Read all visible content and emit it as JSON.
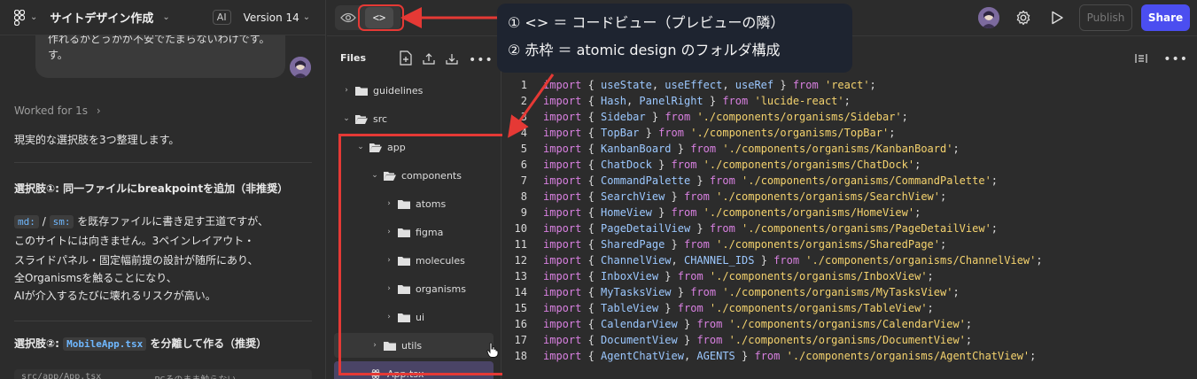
{
  "header": {
    "project_title": "サイトデザイン作成",
    "ai_badge": "AI",
    "version": "Version 14"
  },
  "chat": {
    "bubble_text": "作れるかどうかが不安でたまらないわけです。",
    "bubble_line2": "す。",
    "worked_label": "Worked for 1s",
    "intro": "現実的な選択肢を3つ整理します。",
    "option1_title": "選択肢①: 同一ファイルにbreakpointを追加（非推奨）",
    "option1_chip_a": "md:",
    "option1_sep": "/",
    "option1_chip_b": "sm:",
    "option1_line1_rest": "を既存ファイルに書き足す王道ですが、",
    "option1_line2": "このサイトには向きません。3ペインレイアウト・",
    "option1_line3": "スライドパネル・固定幅前提の設計が随所にあり、",
    "option1_line4": "全Organismsを触ることになり、",
    "option1_line5": "AIが介入するたびに壊れるリスクが高い。",
    "option2_prefix": "選択肢②:",
    "option2_chip": "MobileApp.tsx",
    "option2_rest": "を分離して作る（推奨）",
    "snippet_left": "src/app/App.tsx",
    "snippet_right": "PCそのまま触らない"
  },
  "toolbar": {
    "publish_label": "Publish",
    "share_label": "Share",
    "code_glyph": "<>"
  },
  "files": {
    "title": "Files",
    "tree": [
      {
        "label": "guidelines",
        "depth": 0,
        "expanded": false
      },
      {
        "label": "src",
        "depth": 0,
        "expanded": true
      },
      {
        "label": "app",
        "depth": 1,
        "expanded": true
      },
      {
        "label": "components",
        "depth": 2,
        "expanded": true
      },
      {
        "label": "atoms",
        "depth": 3,
        "expanded": false
      },
      {
        "label": "figma",
        "depth": 3,
        "expanded": false
      },
      {
        "label": "molecules",
        "depth": 3,
        "expanded": false
      },
      {
        "label": "organisms",
        "depth": 3,
        "expanded": false
      },
      {
        "label": "ui",
        "depth": 3,
        "expanded": false
      },
      {
        "label": "utils",
        "depth": 2,
        "expanded": false
      }
    ],
    "selected_file": "App.tsx"
  },
  "editor": {
    "lines": [
      {
        "n": "1",
        "names": "useState, useEffect, useRef",
        "path": "'react'"
      },
      {
        "n": "2",
        "names": "Hash, PanelRight",
        "path": "'lucide-react'"
      },
      {
        "n": "3",
        "names": "Sidebar",
        "path": "'./components/organisms/Sidebar'"
      },
      {
        "n": "4",
        "names": "TopBar",
        "path": "'./components/organisms/TopBar'"
      },
      {
        "n": "5",
        "names": "KanbanBoard",
        "path": "'./components/organisms/KanbanBoard'"
      },
      {
        "n": "6",
        "names": "ChatDock",
        "path": "'./components/organisms/ChatDock'"
      },
      {
        "n": "7",
        "names": "CommandPalette",
        "path": "'./components/organisms/CommandPalette'"
      },
      {
        "n": "8",
        "names": "SearchView",
        "path": "'./components/organisms/SearchView'"
      },
      {
        "n": "9",
        "names": "HomeView",
        "path": "'./components/organisms/HomeView'"
      },
      {
        "n": "10",
        "names": "PageDetailView",
        "path": "'./components/organisms/PageDetailView'"
      },
      {
        "n": "11",
        "names": "SharedPage",
        "path": "'./components/organisms/SharedPage'"
      },
      {
        "n": "12",
        "names": "ChannelView, CHANNEL_IDS",
        "path": "'./components/organisms/ChannelView'"
      },
      {
        "n": "13",
        "names": "InboxView",
        "path": "'./components/organisms/InboxView'"
      },
      {
        "n": "14",
        "names": "MyTasksView",
        "path": "'./components/organisms/MyTasksView'"
      },
      {
        "n": "15",
        "names": "TableView",
        "path": "'./components/organisms/TableView'"
      },
      {
        "n": "16",
        "names": "CalendarView",
        "path": "'./components/organisms/CalendarView'"
      },
      {
        "n": "17",
        "names": "DocumentView",
        "path": "'./components/organisms/DocumentView'"
      },
      {
        "n": "18",
        "names": "AgentChatView, AGENTS",
        "path": "'./components/organisms/AgentChatView'"
      }
    ],
    "kw_import": "import",
    "kw_from": "from"
  },
  "annotation": {
    "line1": "①  <>  ＝ コードビュー（プレビューの隣）",
    "line2": "②  赤枠 ＝ atomic design のフォルダ構成"
  },
  "colors": {
    "accent_share": "#4b4ef0",
    "annotation_red": "#e53935",
    "keyword": "#d880e0",
    "string": "#f5d36e",
    "identifier": "#9cc8ff"
  }
}
